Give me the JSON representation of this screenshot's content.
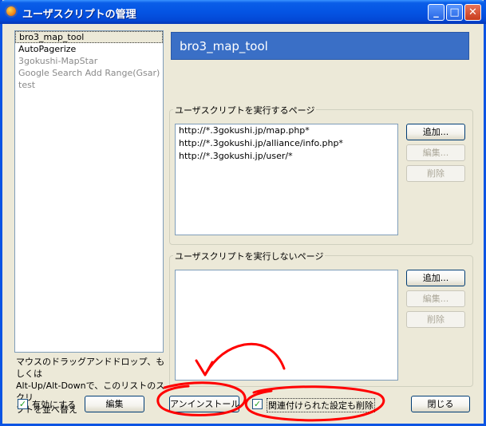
{
  "window": {
    "title": "ユーザスクリプトの管理",
    "minimize_glyph": "_",
    "maximize_glyph": "□",
    "close_glyph": "✕"
  },
  "scripts": [
    {
      "label": "bro3_map_tool",
      "selected": true,
      "enabled": true
    },
    {
      "label": "AutoPagerize",
      "selected": false,
      "enabled": true
    },
    {
      "label": "3gokushi-MapStar",
      "selected": false,
      "enabled": false
    },
    {
      "label": "Google Search Add Range(Gsar)",
      "selected": false,
      "enabled": false
    },
    {
      "label": "test",
      "selected": false,
      "enabled": false
    }
  ],
  "hint": {
    "line1": "マウスのドラッグアンドドロップ、もしくは",
    "line2": "Alt-Up/Alt-Downで、このリストのスクリ",
    "line3": "プトを並べ替え"
  },
  "selected_name": "bro3_map_tool",
  "include": {
    "label": "ユーザスクリプトを実行するページ",
    "urls": [
      "http://*.3gokushi.jp/map.php*",
      "http://*.3gokushi.jp/alliance/info.php*",
      "http://*.3gokushi.jp/user/*"
    ],
    "add": "追加...",
    "edit": "編集...",
    "remove": "削除"
  },
  "exclude": {
    "label": "ユーザスクリプトを実行しないページ",
    "urls": [],
    "add": "追加...",
    "edit": "編集...",
    "remove": "削除"
  },
  "footer": {
    "enable_label": "有効にする",
    "enable_checked": true,
    "edit": "編集",
    "uninstall": "アンインストール",
    "delete_prefs_label": "関連付けられた設定も削除",
    "delete_prefs_checked": true,
    "close": "閉じる"
  },
  "colors": {
    "titlebar": "#0454e3",
    "banner": "#3a6fc6",
    "annotation": "#ff0000"
  }
}
